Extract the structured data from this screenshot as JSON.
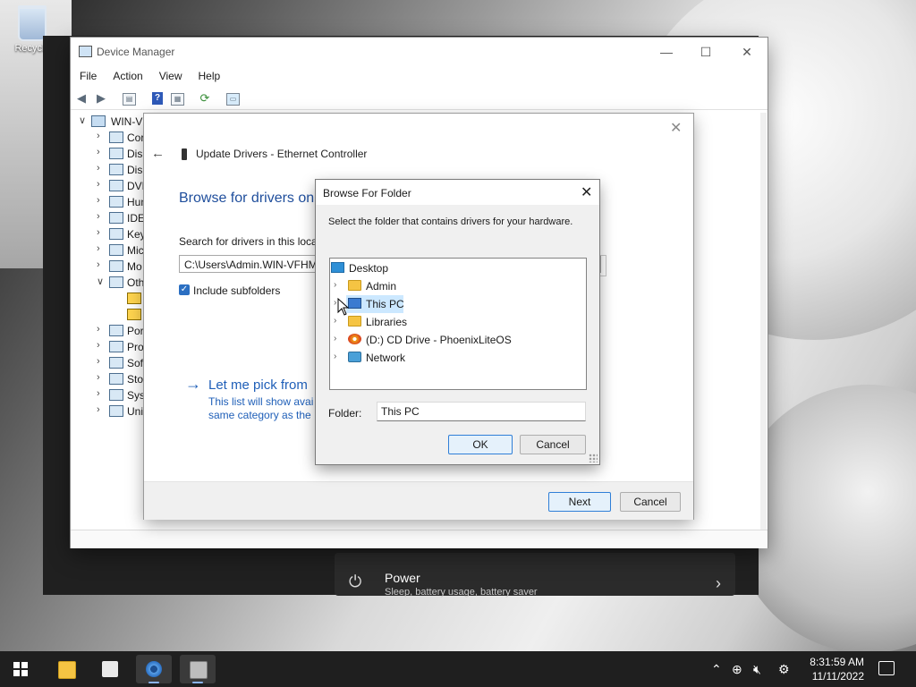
{
  "desktop": {
    "recycle_label": "Recycle"
  },
  "settings_bg": {
    "power_title": "Power",
    "power_sub": "Sleep, battery usage, battery saver"
  },
  "devmgr": {
    "title": "Device Manager",
    "menu": [
      "File",
      "Action",
      "View",
      "Help"
    ],
    "tree_root": "WIN-VF",
    "tree_items": [
      "Cor",
      "Disk",
      "Disp",
      "DVD",
      "Hun",
      "IDE",
      "Key",
      "Mic",
      "Mo",
      "Oth",
      "Por",
      "Pro",
      "Soft",
      "Stor",
      "Syst",
      "Uni"
    ]
  },
  "wizard": {
    "title": "Update Drivers - Ethernet Controller",
    "heading": "Browse for drivers on",
    "search_label": "Search for drivers in this locat",
    "path_value": "C:\\Users\\Admin.WIN-VFHM",
    "include_subfolders": "Include subfolders",
    "pick_title": "Let me pick from",
    "pick_desc_1": "This list will show avail",
    "pick_desc_2": "same category as the d",
    "next": "Next",
    "cancel": "Cancel"
  },
  "browse": {
    "title": "Browse For Folder",
    "description": "Select the folder that contains drivers for your hardware.",
    "tree": [
      {
        "label": "Desktop",
        "icon": "desktop-icon"
      },
      {
        "label": "Admin",
        "icon": "folder-icon"
      },
      {
        "label": "This PC",
        "icon": "pc-icon"
      },
      {
        "label": "Libraries",
        "icon": "folder-icon"
      },
      {
        "label": "(D:) CD Drive - PhoenixLiteOS",
        "icon": "cd-drive-icon"
      },
      {
        "label": "Network",
        "icon": "network-icon"
      }
    ],
    "folder_label": "Folder:",
    "folder_value": "This PC",
    "ok": "OK",
    "cancel": "Cancel"
  },
  "taskbar": {
    "time": "8:31:59 AM",
    "date": "11/11/2022"
  }
}
